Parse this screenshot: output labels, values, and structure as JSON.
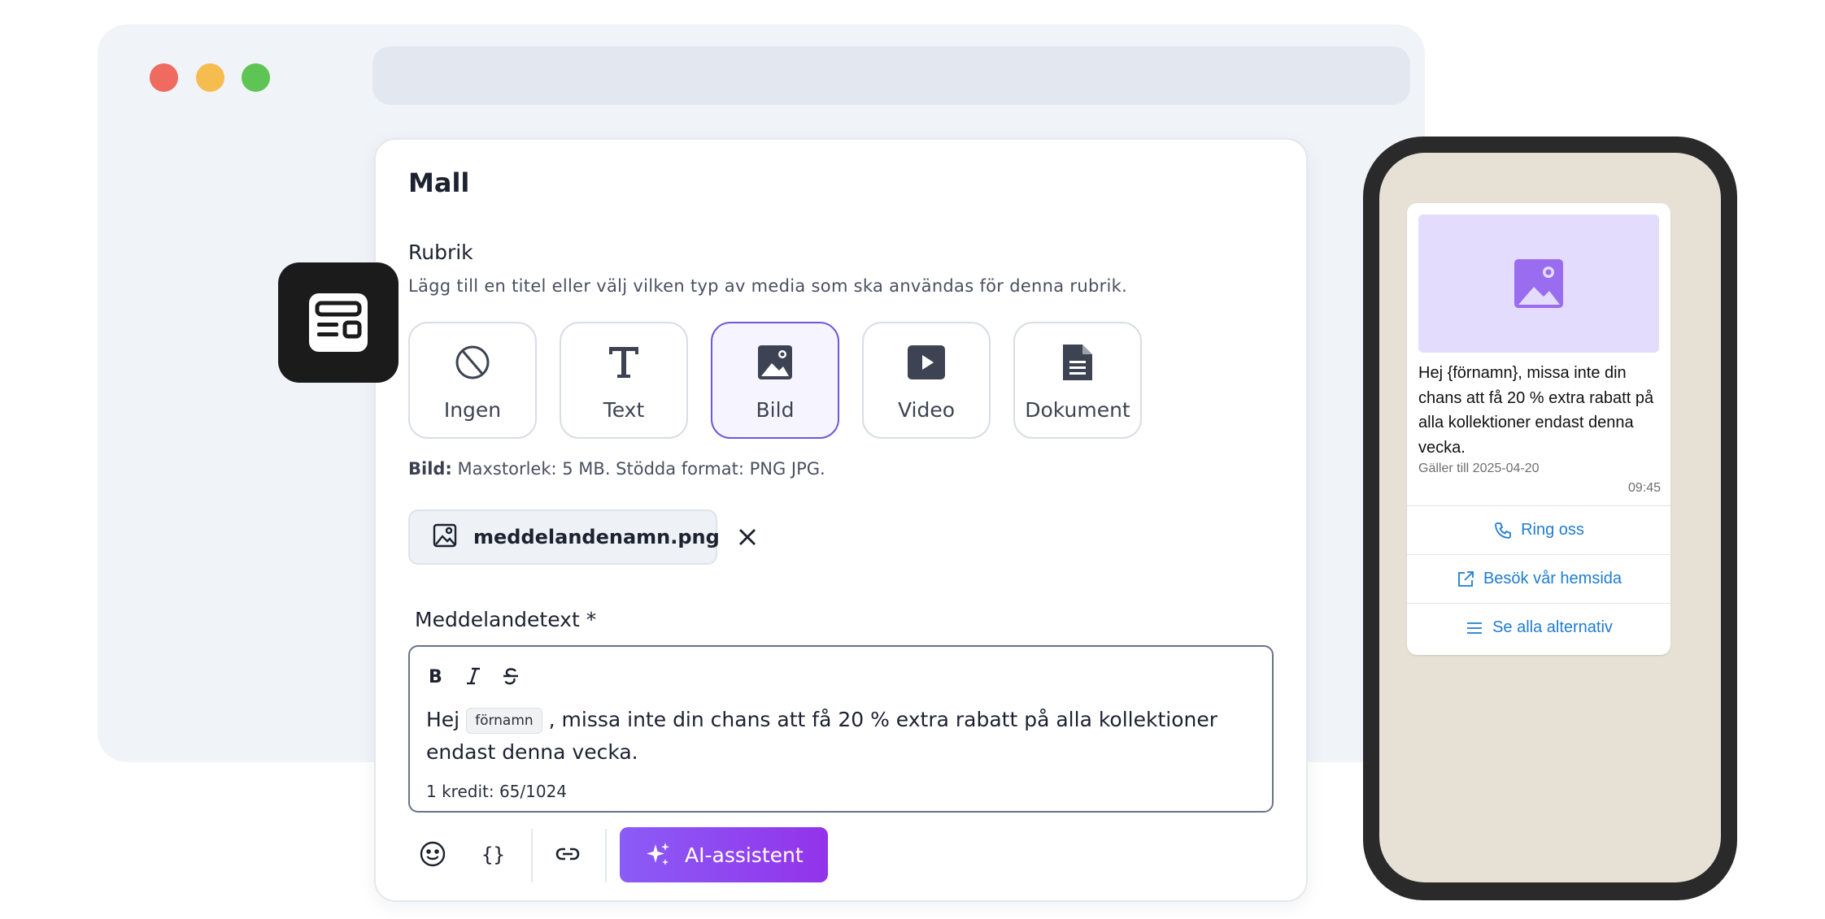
{
  "card": {
    "title": "Mall",
    "section_title": "Rubrik",
    "section_desc": "Lägg till en titel eller välj vilken typ av media som ska användas för denna rubrik.",
    "media_options": [
      {
        "label": "Ingen",
        "icon": "no-media-icon",
        "selected": false
      },
      {
        "label": "Text",
        "icon": "text-icon",
        "selected": false
      },
      {
        "label": "Bild",
        "icon": "image-icon",
        "selected": true
      },
      {
        "label": "Video",
        "icon": "video-icon",
        "selected": false
      },
      {
        "label": "Dokument",
        "icon": "document-icon",
        "selected": false
      }
    ],
    "hint_bold": "Bild:",
    "hint_text": " Maxstorlek: 5 MB. Stödda format: PNG JPG.",
    "file_name": "meddelandenamn.png",
    "message_label": "Meddelandetext *",
    "message_before": "Hej ",
    "message_variable": "förnamn",
    "message_after": " , missa inte din chans att få 20 % extra rabatt på alla kollektioner endast denna vecka.",
    "counter": "1 kredit: 65/1024",
    "ai_button": "AI-assistent"
  },
  "phone": {
    "message": "Hej {förnamn}, missa inte din chans att få 20 % extra rabatt på alla kollektioner endast denna vecka.",
    "valid_until": "Gäller till 2025-04-20",
    "time": "09:45",
    "buttons": [
      {
        "label": "Ring oss",
        "icon": "phone-icon"
      },
      {
        "label": "Besök vår hemsida",
        "icon": "external-link-icon"
      },
      {
        "label": "Se alla alternativ",
        "icon": "list-icon"
      }
    ]
  },
  "colors": {
    "accent": "#6b5bd8",
    "ai_gradient_start": "#8b5cf6",
    "ai_gradient_end": "#9333ea",
    "link_blue": "#1f7ccf",
    "chat_background": "#e7e0d5"
  }
}
